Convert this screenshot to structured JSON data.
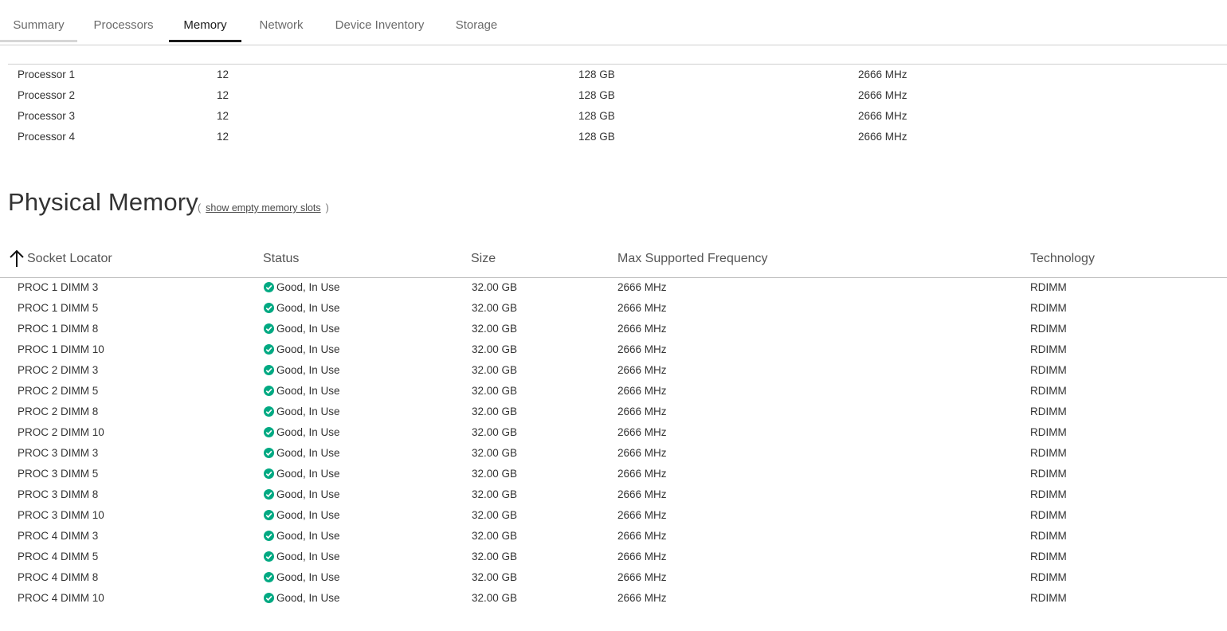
{
  "tabs": [
    {
      "label": "Summary"
    },
    {
      "label": "Processors"
    },
    {
      "label": "Memory"
    },
    {
      "label": "Network"
    },
    {
      "label": "Device Inventory"
    },
    {
      "label": "Storage"
    }
  ],
  "active_tab": "Memory",
  "processor_summary": {
    "rows": [
      {
        "name": "Processor 1",
        "count": "12",
        "total": "128 GB",
        "freq": "2666 MHz"
      },
      {
        "name": "Processor 2",
        "count": "12",
        "total": "128 GB",
        "freq": "2666 MHz"
      },
      {
        "name": "Processor 3",
        "count": "12",
        "total": "128 GB",
        "freq": "2666 MHz"
      },
      {
        "name": "Processor 4",
        "count": "12",
        "total": "128 GB",
        "freq": "2666 MHz"
      }
    ]
  },
  "physical_memory": {
    "title": "Physical Memory",
    "show_empty_open": "(",
    "show_empty_link": "show empty memory slots",
    "show_empty_close": ")",
    "columns": [
      "Socket Locator",
      "Status",
      "Size",
      "Max Supported Frequency",
      "Technology"
    ],
    "status_color": "#01a982",
    "rows": [
      {
        "locator": "PROC 1 DIMM 3",
        "status": "Good, In Use",
        "size": "32.00 GB",
        "freq": "2666 MHz",
        "tech": "RDIMM"
      },
      {
        "locator": "PROC 1 DIMM 5",
        "status": "Good, In Use",
        "size": "32.00 GB",
        "freq": "2666 MHz",
        "tech": "RDIMM"
      },
      {
        "locator": "PROC 1 DIMM 8",
        "status": "Good, In Use",
        "size": "32.00 GB",
        "freq": "2666 MHz",
        "tech": "RDIMM"
      },
      {
        "locator": "PROC 1 DIMM 10",
        "status": "Good, In Use",
        "size": "32.00 GB",
        "freq": "2666 MHz",
        "tech": "RDIMM"
      },
      {
        "locator": "PROC 2 DIMM 3",
        "status": "Good, In Use",
        "size": "32.00 GB",
        "freq": "2666 MHz",
        "tech": "RDIMM"
      },
      {
        "locator": "PROC 2 DIMM 5",
        "status": "Good, In Use",
        "size": "32.00 GB",
        "freq": "2666 MHz",
        "tech": "RDIMM"
      },
      {
        "locator": "PROC 2 DIMM 8",
        "status": "Good, In Use",
        "size": "32.00 GB",
        "freq": "2666 MHz",
        "tech": "RDIMM"
      },
      {
        "locator": "PROC 2 DIMM 10",
        "status": "Good, In Use",
        "size": "32.00 GB",
        "freq": "2666 MHz",
        "tech": "RDIMM"
      },
      {
        "locator": "PROC 3 DIMM 3",
        "status": "Good, In Use",
        "size": "32.00 GB",
        "freq": "2666 MHz",
        "tech": "RDIMM"
      },
      {
        "locator": "PROC 3 DIMM 5",
        "status": "Good, In Use",
        "size": "32.00 GB",
        "freq": "2666 MHz",
        "tech": "RDIMM"
      },
      {
        "locator": "PROC 3 DIMM 8",
        "status": "Good, In Use",
        "size": "32.00 GB",
        "freq": "2666 MHz",
        "tech": "RDIMM"
      },
      {
        "locator": "PROC 3 DIMM 10",
        "status": "Good, In Use",
        "size": "32.00 GB",
        "freq": "2666 MHz",
        "tech": "RDIMM"
      },
      {
        "locator": "PROC 4 DIMM 3",
        "status": "Good, In Use",
        "size": "32.00 GB",
        "freq": "2666 MHz",
        "tech": "RDIMM"
      },
      {
        "locator": "PROC 4 DIMM 5",
        "status": "Good, In Use",
        "size": "32.00 GB",
        "freq": "2666 MHz",
        "tech": "RDIMM"
      },
      {
        "locator": "PROC 4 DIMM 8",
        "status": "Good, In Use",
        "size": "32.00 GB",
        "freq": "2666 MHz",
        "tech": "RDIMM"
      },
      {
        "locator": "PROC 4 DIMM 10",
        "status": "Good, In Use",
        "size": "32.00 GB",
        "freq": "2666 MHz",
        "tech": "RDIMM"
      }
    ]
  }
}
